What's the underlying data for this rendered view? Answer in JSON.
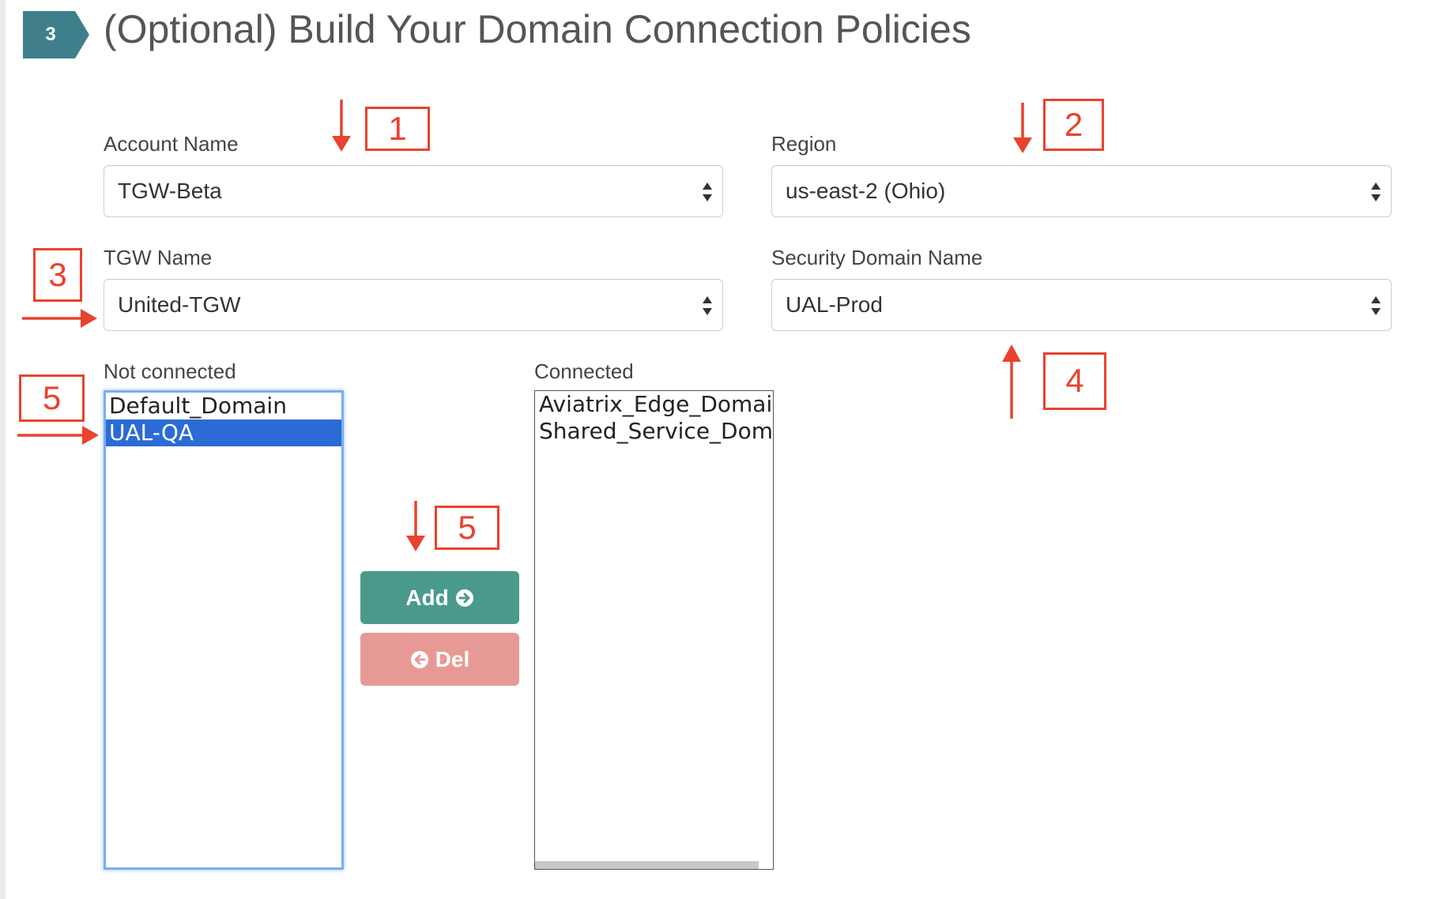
{
  "header": {
    "step_number": "3",
    "title": "(Optional) Build Your Domain Connection Policies"
  },
  "form": {
    "account_name": {
      "label": "Account Name",
      "value": "TGW-Beta"
    },
    "region": {
      "label": "Region",
      "value": "us-east-2 (Ohio)"
    },
    "tgw_name": {
      "label": "TGW Name",
      "value": "United-TGW"
    },
    "security_domain_name": {
      "label": "Security Domain Name",
      "value": "UAL-Prod"
    }
  },
  "lists": {
    "not_connected": {
      "label": "Not connected",
      "items": [
        "Default_Domain",
        "UAL-QA"
      ],
      "selected": "UAL-QA"
    },
    "connected": {
      "label": "Connected",
      "items": [
        "Aviatrix_Edge_Domain",
        "Shared_Service_Domai"
      ]
    }
  },
  "buttons": {
    "add_label": "Add",
    "del_label": "Del"
  },
  "annotations": [
    "1",
    "2",
    "3",
    "4",
    "5",
    "5"
  ],
  "colors": {
    "badge": "#3f7f8c",
    "add_button": "#4a9a8c",
    "del_button": "#e79a95",
    "annotation": "#e8432d",
    "selected_item": "#2b6bd6"
  }
}
